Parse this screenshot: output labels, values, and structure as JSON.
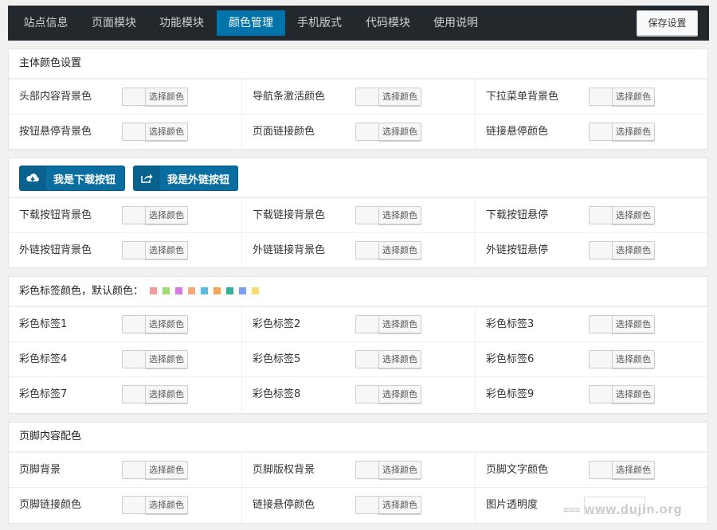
{
  "nav": {
    "tabs": [
      {
        "label": "站点信息"
      },
      {
        "label": "页面模块"
      },
      {
        "label": "功能模块"
      },
      {
        "label": "颜色管理"
      },
      {
        "label": "手机版式"
      },
      {
        "label": "代码模块"
      },
      {
        "label": "使用说明"
      }
    ],
    "active_tab": "颜色管理",
    "save_label": "保存设置"
  },
  "picker_label": "选择颜色",
  "main_colors": {
    "title": "主体颜色设置",
    "rows": [
      [
        "头部内容背景色",
        "导航条激活颜色",
        "下拉菜单背景色"
      ],
      [
        "按钮悬停背景色",
        "页面链接颜色",
        "链接悬停颜色"
      ]
    ]
  },
  "buttons": {
    "download_label": "我是下载按钮",
    "external_label": "我是外链按钮",
    "rows": [
      [
        "下载按钮背景色",
        "下载链接背景色",
        "下载按钮悬停"
      ],
      [
        "外链按钮背景色",
        "外链链接背景色",
        "外链按钮悬停"
      ]
    ]
  },
  "tags": {
    "title": "彩色标签颜色，默认颜色：",
    "default_colors": [
      "#f39a9a",
      "#a0db6e",
      "#d77ae0",
      "#f5a87a",
      "#58bde0",
      "#f4a555",
      "#2fb59a",
      "#7b9ff0",
      "#f7dc6f"
    ],
    "rows": [
      [
        "彩色标签1",
        "彩色标签2",
        "彩色标签3"
      ],
      [
        "彩色标签4",
        "彩色标签5",
        "彩色标签6"
      ],
      [
        "彩色标签7",
        "彩色标签8",
        "彩色标签9"
      ]
    ]
  },
  "footer": {
    "title": "页脚内容配色",
    "rows": [
      [
        "页脚背景",
        "页脚版权背景",
        "页脚文字颜色"
      ],
      [
        "页脚链接颜色",
        "链接悬停颜色",
        "图片透明度"
      ]
    ]
  },
  "watermark": {
    "wave": "≈≈≈",
    "text": "www.dujin.org"
  },
  "colors": {
    "accent": "#0073aa",
    "topbar": "#23282d",
    "button": "#0a6fa0"
  }
}
